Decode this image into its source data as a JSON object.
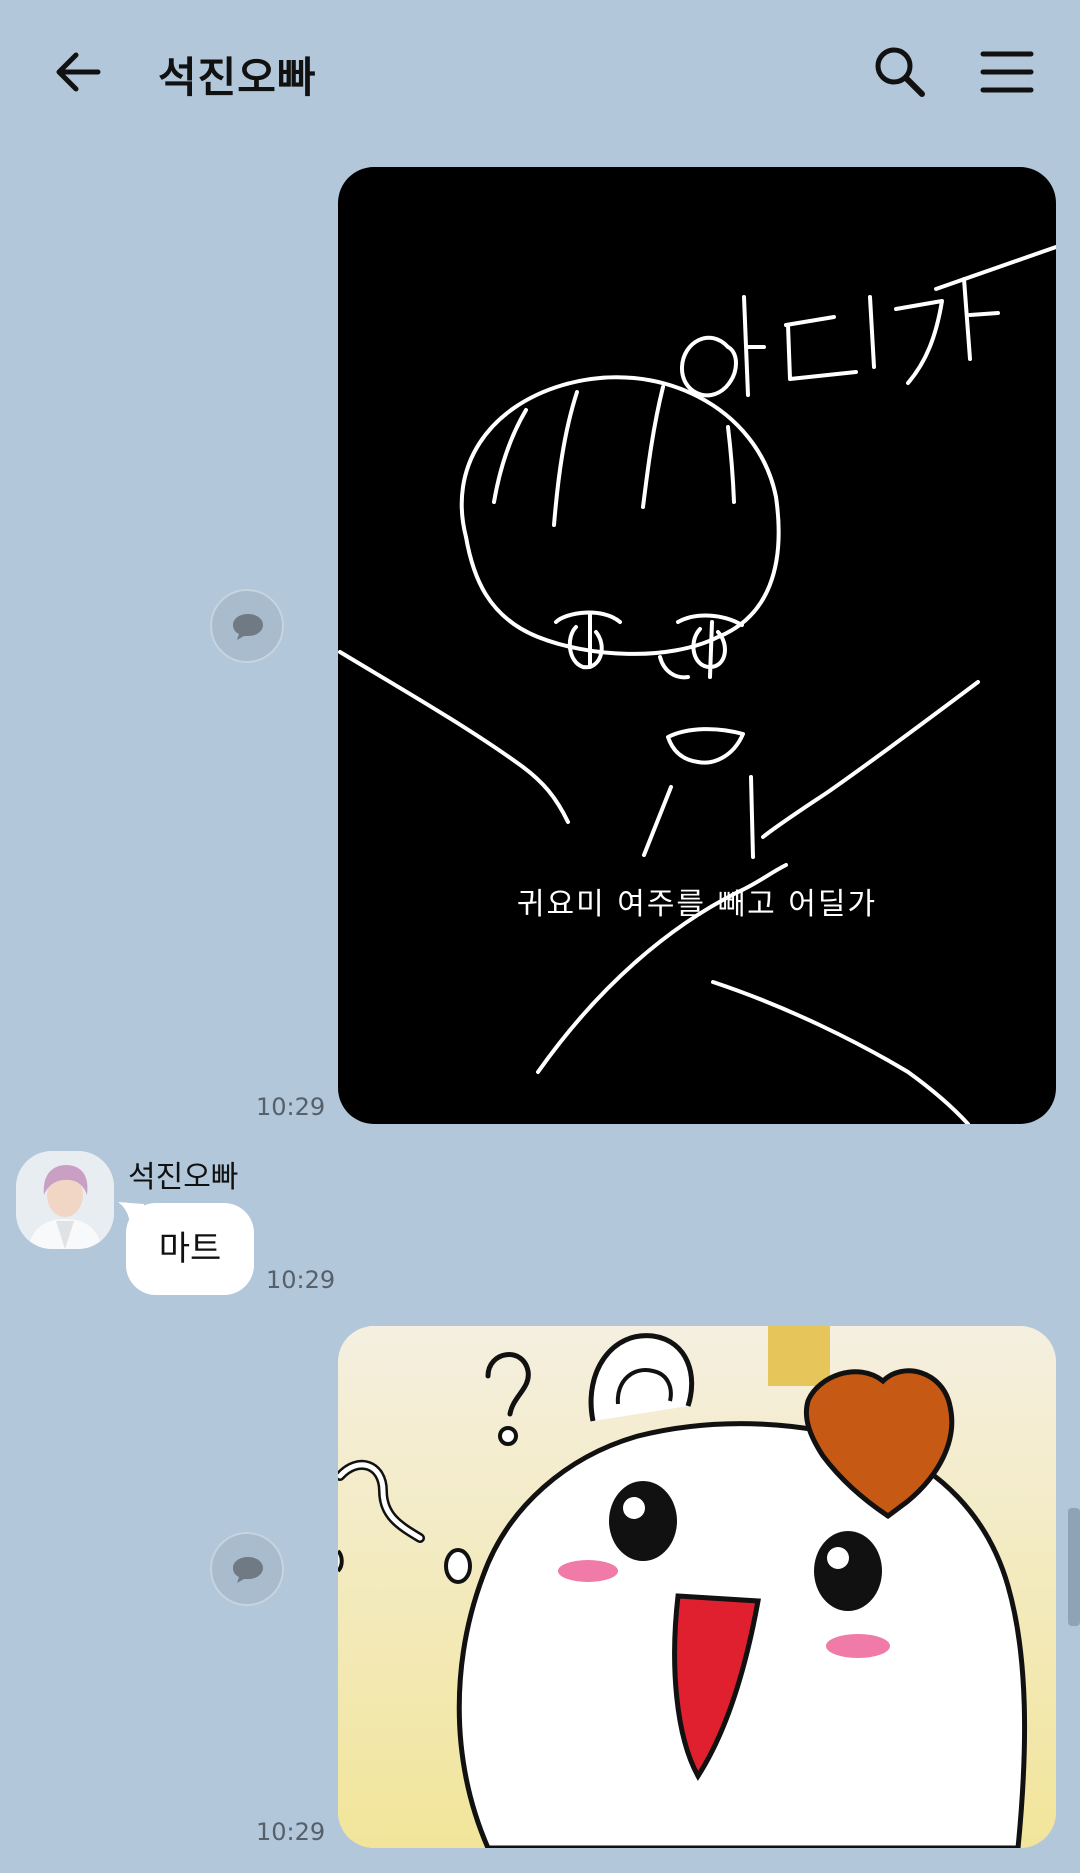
{
  "header": {
    "title": "석진오빠",
    "back_icon": "arrow-left-icon",
    "search_icon": "search-icon",
    "menu_icon": "hamburger-menu-icon"
  },
  "messages": [
    {
      "type": "image",
      "outgoing": true,
      "image_subject": "hand-drawn doodle on black background",
      "image_handwriting": "어디가",
      "image_caption": "귀요미 여주를 빼고 어딜가",
      "time": "10:29"
    },
    {
      "type": "text",
      "outgoing": false,
      "sender": "석진오빠",
      "text": "마트",
      "time": "10:29"
    },
    {
      "type": "image",
      "outgoing": true,
      "image_subject": "cartoon hamster with question marks",
      "time": "10:29"
    }
  ],
  "colors": {
    "background": "#b2c7da",
    "bubble_incoming": "#ffffff"
  }
}
